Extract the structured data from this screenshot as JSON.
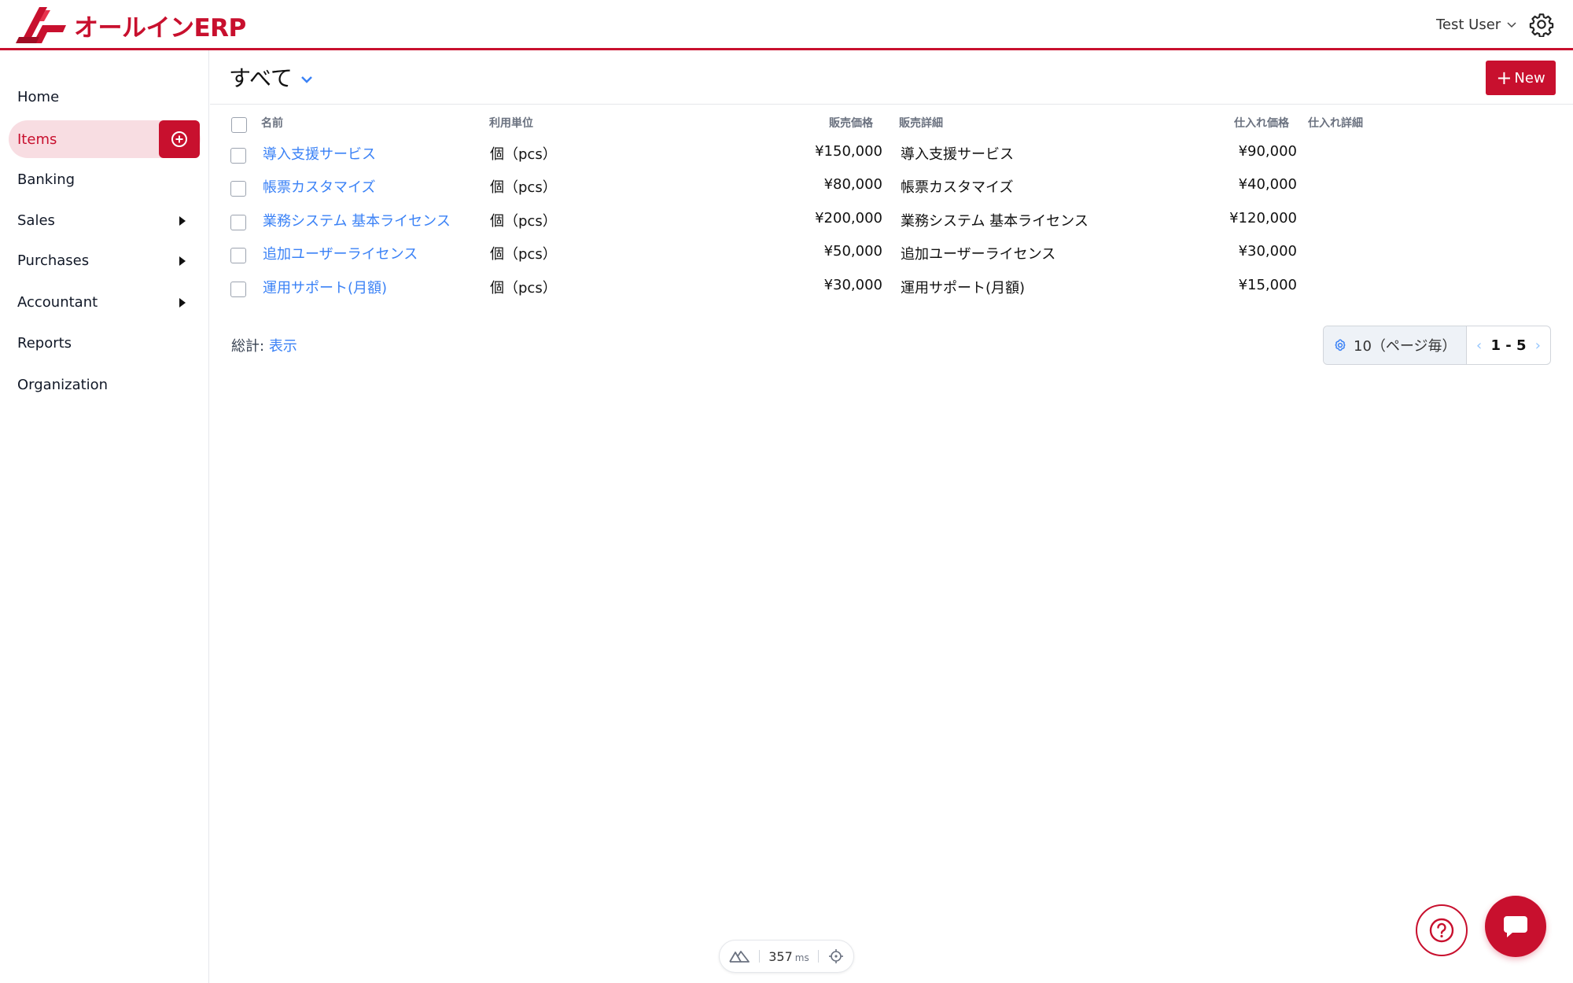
{
  "header": {
    "logo_text": "オールインERP",
    "user_name": "Test User",
    "icons": [
      "chevron-down-icon",
      "gear-icon"
    ]
  },
  "sidebar": {
    "items": [
      {
        "label": "Home",
        "has_arrow": false
      },
      {
        "label": "Items",
        "active": true,
        "has_arrow": false
      },
      {
        "label": "Banking",
        "has_arrow": false
      },
      {
        "label": "Sales",
        "has_arrow": true
      },
      {
        "label": "Purchases",
        "has_arrow": true
      },
      {
        "label": "Accountant",
        "has_arrow": true
      },
      {
        "label": "Reports",
        "has_arrow": false
      },
      {
        "label": "Organization",
        "has_arrow": false
      }
    ],
    "add_icon": "plus-circle-icon"
  },
  "main": {
    "view_title": "すべて",
    "new_button": {
      "plus": "+",
      "label": "New"
    },
    "columns": [
      "名前",
      "利用単位",
      "販売価格",
      "販売詳細",
      "仕入れ価格",
      "仕入れ詳細"
    ],
    "rows": [
      {
        "name": "導入支援サービス",
        "unit": "個（pcs）",
        "sale_price": "¥150,000",
        "sale_detail": "導入支援サービス",
        "purchase_price": "¥90,000",
        "purchase_detail": ""
      },
      {
        "name": "帳票カスタマイズ",
        "unit": "個（pcs）",
        "sale_price": "¥80,000",
        "sale_detail": "帳票カスタマイズ",
        "purchase_price": "¥40,000",
        "purchase_detail": ""
      },
      {
        "name": "業務システム 基本ライセンス",
        "unit": "個（pcs）",
        "sale_price": "¥200,000",
        "sale_detail": "業務システム 基本ライセンス",
        "purchase_price": "¥120,000",
        "purchase_detail": ""
      },
      {
        "name": "追加ユーザーライセンス",
        "unit": "個（pcs）",
        "sale_price": "¥50,000",
        "sale_detail": "追加ユーザーライセンス",
        "purchase_price": "¥30,000",
        "purchase_detail": ""
      },
      {
        "name": "運用サポート(月額)",
        "unit": "個（pcs）",
        "sale_price": "¥30,000",
        "sale_detail": "運用サポート(月額)",
        "purchase_price": "¥15,000",
        "purchase_detail": ""
      }
    ],
    "totals": {
      "label": "総計:",
      "link": "表示"
    },
    "pager": {
      "per_page": "10（ページ毎）",
      "range": "1 - 5",
      "prev": "‹",
      "next": "›"
    }
  },
  "perf": {
    "value": "357",
    "unit": "ms"
  },
  "colors": {
    "brand": "#c8102e",
    "link": "#3b82f6",
    "active_bg": "#f8dde2"
  }
}
